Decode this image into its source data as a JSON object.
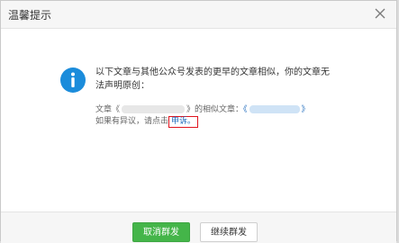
{
  "dialog": {
    "title": "温馨提示",
    "close_icon": "close-icon",
    "message": "以下文章与其他公众号发表的更早的文章相似，你的文章无法声明原创：",
    "article_prefix": "文章《",
    "article_middle": "》的相似文章：",
    "article_suffix": "》",
    "similar_prefix": "《",
    "complaint_prefix": "如果有异议，请点击",
    "complaint_link": "申诉",
    "complaint_suffix": "。",
    "icon": "info-icon",
    "accent_color": "#1b8cdb"
  },
  "buttons": {
    "cancel_label": "取消群发",
    "continue_label": "继续群发",
    "primary_color": "#44b549"
  }
}
